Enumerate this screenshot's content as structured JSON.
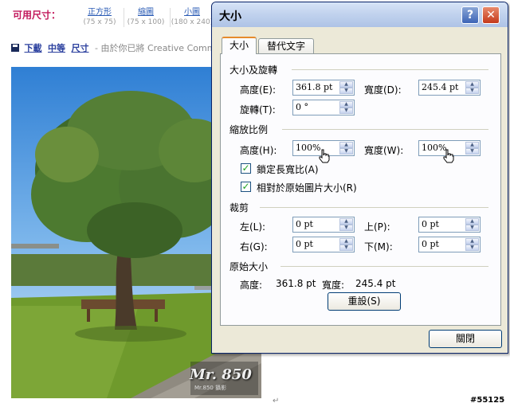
{
  "page": {
    "sizes_label": "可用尺寸：",
    "sizes": [
      {
        "name": "正方形",
        "dim": "(75 x 75)"
      },
      {
        "name": "縮圖",
        "dim": "(75 x 100)"
      },
      {
        "name": "小圖",
        "dim": "(180 x 240)"
      }
    ],
    "download_links": [
      "下載",
      "中等",
      "尺寸"
    ],
    "download_suffix": "- 由於你已將 Creative Commons",
    "watermark": "Mr. 850",
    "watermark_sub": "Mr.850 攝影",
    "para_mark": "↵",
    "corner_id": "#55125"
  },
  "dialog": {
    "title": "大小",
    "help": "?",
    "close": "✕",
    "tabs": [
      "大小",
      "替代文字"
    ],
    "size_rotate": {
      "title": "大小及旋轉",
      "height_label": "高度(E):",
      "height_value": "361.8 pt",
      "width_label": "寬度(D):",
      "width_value": "245.4 pt",
      "rotate_label": "旋轉(T):",
      "rotate_value": "0 °"
    },
    "scale": {
      "title": "縮放比例",
      "height_label": "高度(H):",
      "height_value": "100%",
      "width_label": "寬度(W):",
      "width_value": "100%",
      "lock_label": "鎖定長寬比(A)",
      "lock_checked": true,
      "relative_label": "相對於原始圖片大小(R)",
      "relative_checked": true
    },
    "crop": {
      "title": "裁剪",
      "left_label": "左(L):",
      "left_value": "0 pt",
      "top_label": "上(P):",
      "top_value": "0 pt",
      "right_label": "右(G):",
      "right_value": "0 pt",
      "bottom_label": "下(M):",
      "bottom_value": "0 pt"
    },
    "original": {
      "title": "原始大小",
      "height_label": "高度:",
      "height_value": "361.8 pt",
      "width_label": "寬度:",
      "width_value": "245.4 pt",
      "reset_label": "重設(S)"
    },
    "close_button": "關閉"
  },
  "colors": {
    "accent_tab": "#e68b2c",
    "title_bar": "#c2d3ee",
    "link": "#2a5bb5",
    "sizes_label": "#c2185b"
  }
}
